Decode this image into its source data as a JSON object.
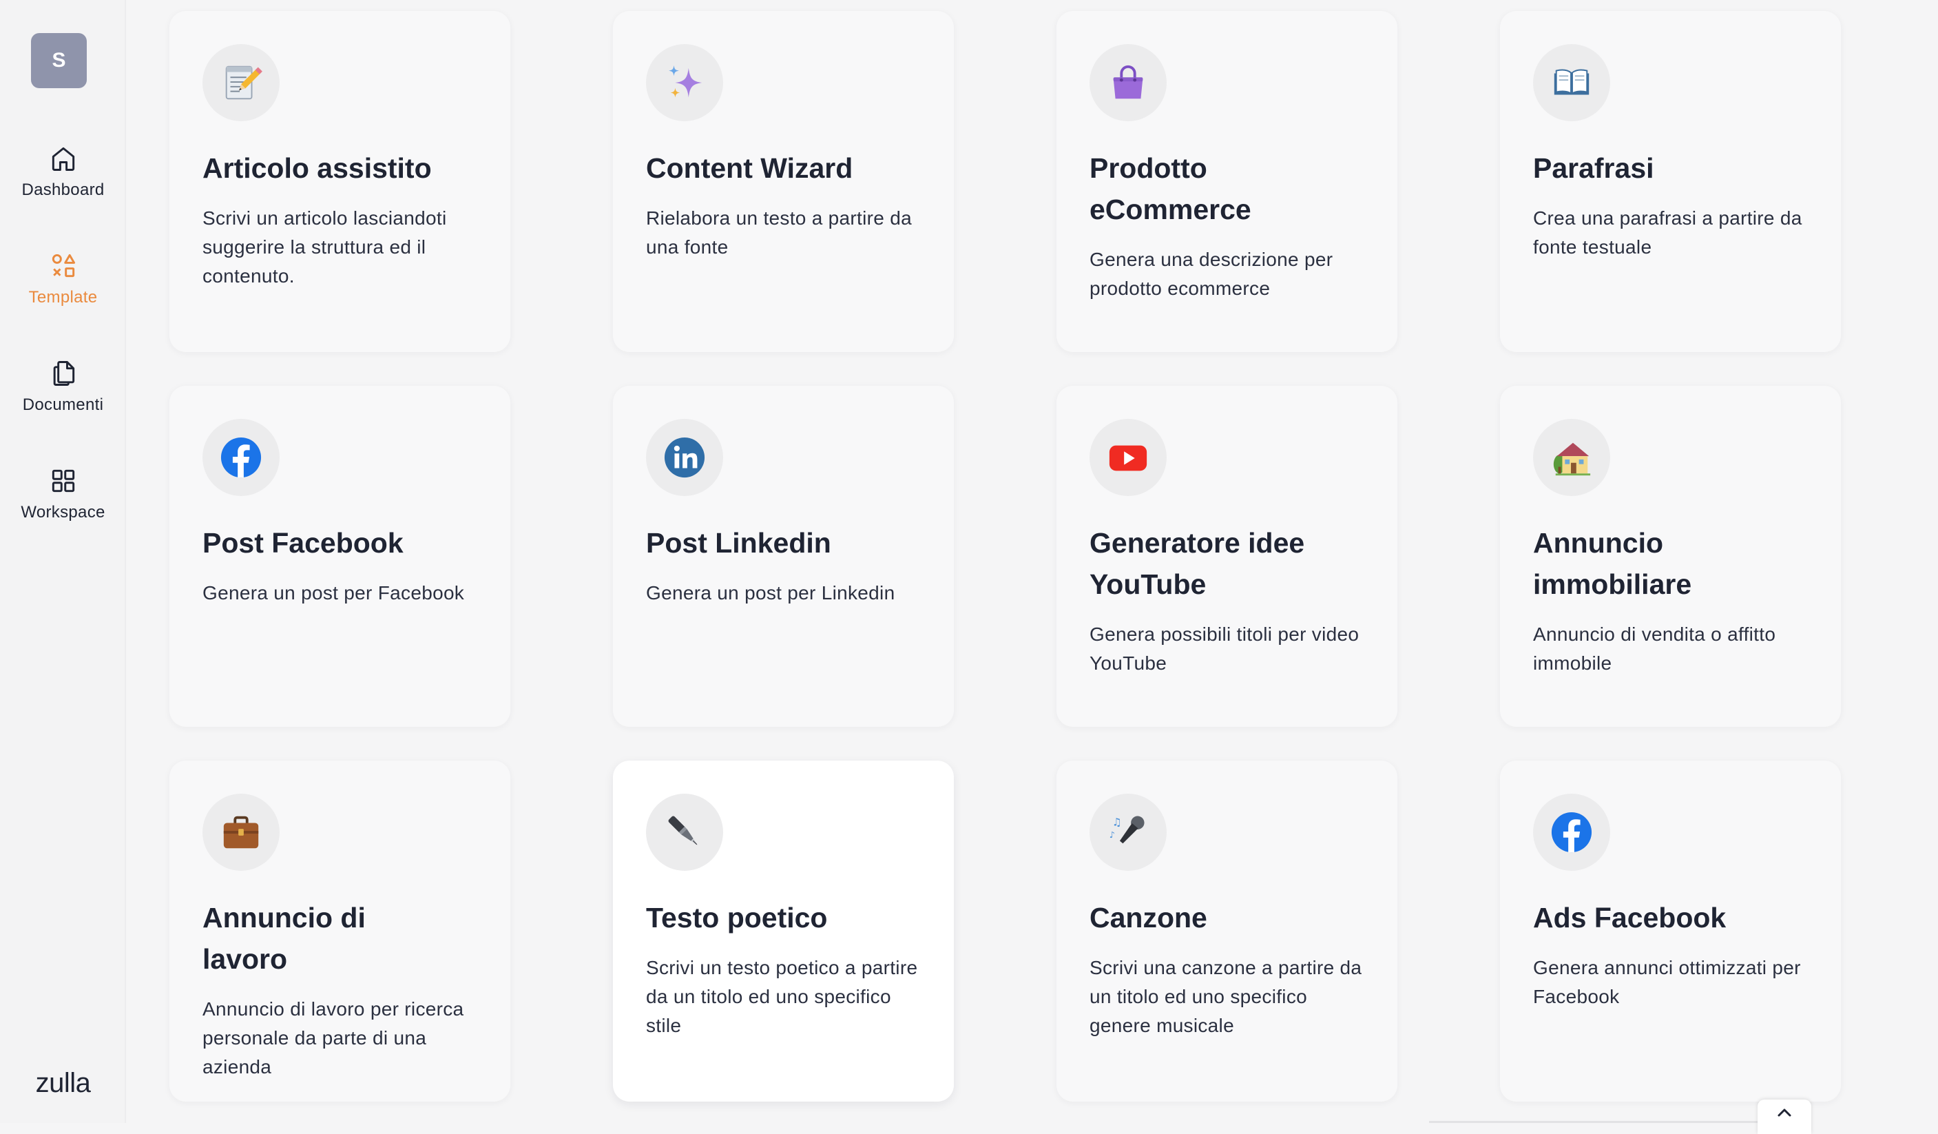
{
  "sidebar": {
    "avatar_initial": "S",
    "items": [
      {
        "label": "Dashboard",
        "icon": "home-icon"
      },
      {
        "label": "Template",
        "icon": "shapes-icon",
        "active": true
      },
      {
        "label": "Documenti",
        "icon": "documents-icon"
      },
      {
        "label": "Workspace",
        "icon": "grid-icon"
      }
    ],
    "logo": "zulla",
    "accent_color": "#ea8a3e"
  },
  "templates": [
    {
      "title": "Articolo assistito",
      "desc": "Scrivi un articolo lasciandoti suggerire la struttura ed il contenuto.",
      "icon": "memo-pencil-icon"
    },
    {
      "title": "Content Wizard",
      "desc": "Rielabora un testo a partire da una fonte",
      "icon": "sparkles-icon"
    },
    {
      "title": "Prodotto eCommerce",
      "desc": "Genera una descrizione per prodotto ecommerce",
      "icon": "handbag-icon"
    },
    {
      "title": "Parafrasi",
      "desc": "Crea una parafrasi a partire da fonte testuale",
      "icon": "open-book-icon"
    },
    {
      "title": "Post Facebook",
      "desc": "Genera un post per Facebook",
      "icon": "facebook-icon"
    },
    {
      "title": "Post Linkedin",
      "desc": "Genera un post per Linkedin",
      "icon": "linkedin-icon"
    },
    {
      "title": "Generatore idee YouTube",
      "desc": "Genera possibili titoli per video YouTube",
      "icon": "youtube-icon"
    },
    {
      "title": "Annuncio immobiliare",
      "desc": "Annuncio di vendita o affitto immobile",
      "icon": "house-icon"
    },
    {
      "title": "Annuncio di lavoro",
      "desc": "Annuncio di lavoro per ricerca personale da parte di una azienda",
      "icon": "briefcase-icon"
    },
    {
      "title": "Testo poetico",
      "desc": "Scrivi un testo poetico a partire da un titolo ed uno specifico stile",
      "icon": "fountain-pen-icon"
    },
    {
      "title": "Canzone",
      "desc": "Scrivi una canzone a partire da un titolo ed uno specifico genere musicale",
      "icon": "microphone-icon"
    },
    {
      "title": "Ads Facebook",
      "desc": "Genera annunci ottimizzati per Facebook",
      "icon": "facebook-icon"
    }
  ],
  "scroll_top_icon": "chevron-up-icon"
}
